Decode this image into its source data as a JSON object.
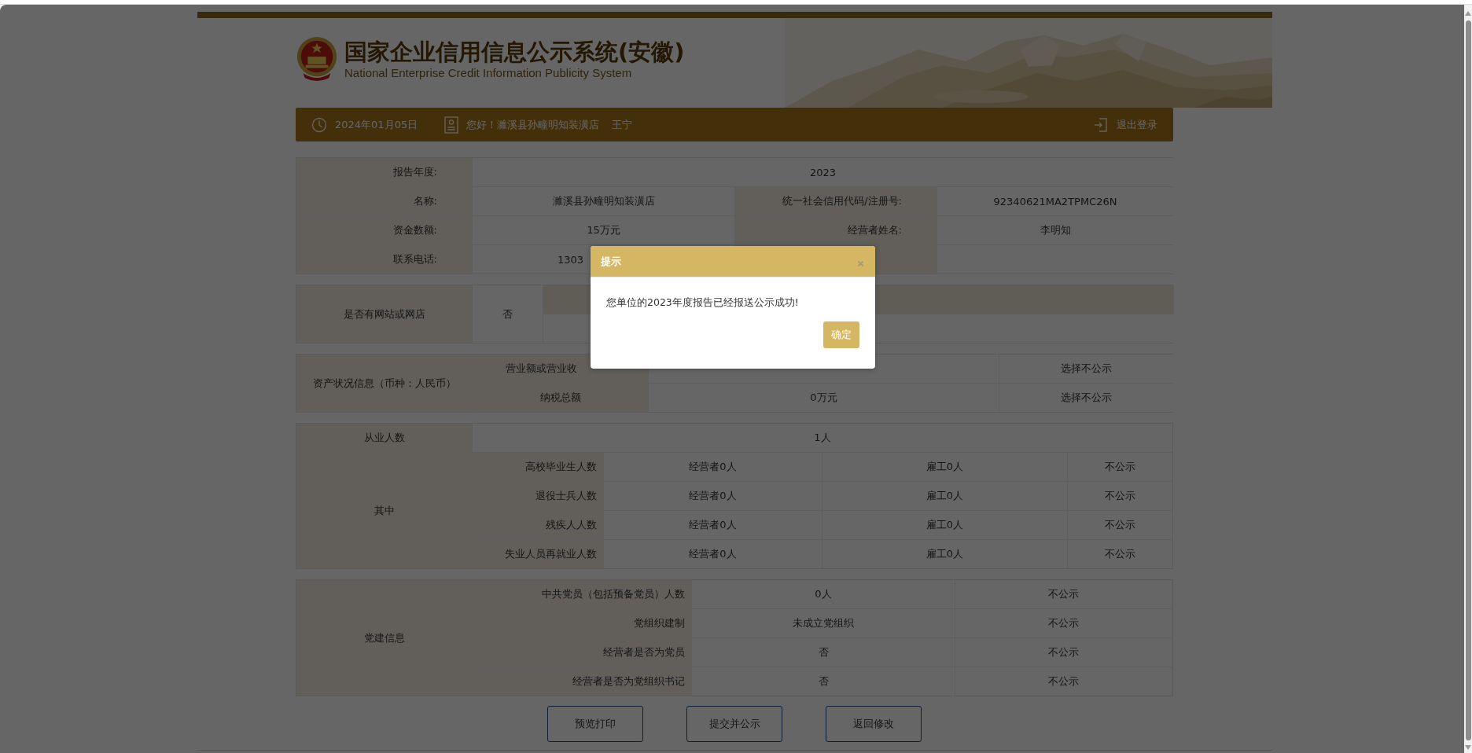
{
  "header": {
    "title": "国家企业信用信息公示系统(安徽)",
    "subtitle": "National Enterprise Credit Information Publicity System"
  },
  "user_bar": {
    "date": "2024年01月05日",
    "greeting": "您好！濉溪县孙疃明知装潢店",
    "user": "王宁",
    "logout": "退出登录"
  },
  "basic_info": [
    [
      {
        "kind": "label",
        "text": "报告年度:"
      },
      {
        "kind": "value",
        "text": "2023"
      }
    ],
    [
      {
        "kind": "label",
        "text": "名称:"
      },
      {
        "kind": "value",
        "text": "濉溪县孙疃明知装潢店"
      },
      {
        "kind": "label",
        "text": "统一社会信用代码/注册号:"
      },
      {
        "kind": "value",
        "text": "92340621MA2TPMC26N"
      }
    ],
    [
      {
        "kind": "label",
        "text": "资金数额:"
      },
      {
        "kind": "value",
        "text": "15万元"
      },
      {
        "kind": "label",
        "text": "经营者姓名:"
      },
      {
        "kind": "value",
        "text": "李明知"
      }
    ],
    [
      {
        "kind": "label",
        "text": "联系电话:"
      },
      {
        "kind": "clipped",
        "text": "1303"
      }
    ]
  ],
  "website": {
    "label": "是否有网站或网店",
    "value": "否"
  },
  "assets": {
    "label": "资产状况信息（币种：人民币）",
    "rows": [
      {
        "item": "营业额或营业收",
        "kind": "clipped",
        "status": "选择不公示"
      },
      {
        "item": "纳税总额",
        "kind": "value",
        "value": "0万元",
        "status": "选择不公示"
      }
    ]
  },
  "employees": {
    "label": "从业人数",
    "value": "1人",
    "group_label": "其中",
    "rows": [
      {
        "item": "高校毕业生人数",
        "operator": "经营者0人",
        "staff": "雇工0人",
        "status": "不公示"
      },
      {
        "item": "退役士兵人数",
        "operator": "经营者0人",
        "staff": "雇工0人",
        "status": "不公示"
      },
      {
        "item": "残疾人人数",
        "operator": "经营者0人",
        "staff": "雇工0人",
        "status": "不公示"
      },
      {
        "item": "失业人员再就业人数",
        "operator": "经营者0人",
        "staff": "雇工0人",
        "status": "不公示"
      }
    ]
  },
  "party": {
    "label": "党建信息",
    "rows": [
      {
        "item": "中共党员（包括预备党员）人数",
        "value": "0人",
        "status": "不公示"
      },
      {
        "item": "党组织建制",
        "value": "未成立党组织",
        "status": "不公示"
      },
      {
        "item": "经营者是否为党员",
        "value": "否",
        "status": "不公示"
      },
      {
        "item": "经营者是否为党组织书记",
        "value": "否",
        "status": "不公示"
      }
    ]
  },
  "buttons": [
    "预览打印",
    "提交并公示",
    "返回修改"
  ],
  "dialog": {
    "title": "提示",
    "message": "您单位的2023年度报告已经报送公示成功!",
    "confirm": "确定"
  }
}
